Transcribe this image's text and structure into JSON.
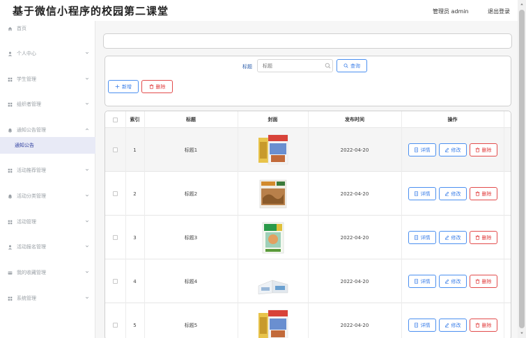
{
  "header": {
    "title": "基于微信小程序的校园第二课堂",
    "user_label": "管理员 admin",
    "logout_label": "退出登录"
  },
  "sidebar": {
    "items": [
      {
        "label": "首页",
        "icon": "home-icon"
      },
      {
        "label": "个人中心",
        "icon": "user-icon"
      },
      {
        "label": "学生管理",
        "icon": "grid-icon"
      },
      {
        "label": "组织者管理",
        "icon": "grid-icon"
      },
      {
        "label": "通知公告管理",
        "icon": "bell-icon"
      },
      {
        "label": "活动推荐管理",
        "icon": "grid-icon"
      },
      {
        "label": "活动分类管理",
        "icon": "bell-icon"
      },
      {
        "label": "活动管理",
        "icon": "grid-icon"
      },
      {
        "label": "活动报名管理",
        "icon": "user-icon"
      },
      {
        "label": "我的收藏管理",
        "icon": "card-icon"
      },
      {
        "label": "系统管理",
        "icon": "grid-icon"
      }
    ],
    "active_sub": "通知公告"
  },
  "search": {
    "label": "标题",
    "placeholder": "标题",
    "query_label": "查询",
    "add_label": "新增",
    "delete_label": "删除"
  },
  "table": {
    "headers": {
      "index": "索引",
      "title": "标题",
      "cover": "封面",
      "time": "发布时间",
      "ops": "操作"
    },
    "rows": [
      {
        "index": "1",
        "title": "标题1",
        "time": "2022-04-20",
        "cover": "magazine-book-cover"
      },
      {
        "index": "2",
        "title": "标题2",
        "time": "2022-04-20",
        "cover": "xinjiaoyu-cover"
      },
      {
        "index": "3",
        "title": "标题3",
        "time": "2022-04-20",
        "cover": "qingnian-wenzhai-cover"
      },
      {
        "index": "4",
        "title": "标题4",
        "time": "2022-04-20",
        "cover": "open-magazine-cover"
      },
      {
        "index": "5",
        "title": "标题5",
        "time": "2022-04-20",
        "cover": "magazine-book-cover"
      }
    ],
    "detail_label": "详情",
    "edit_label": "修改",
    "delete_label": "删除"
  },
  "colors": {
    "primary": "#3a7ee8",
    "danger": "#e03a3a",
    "active_bg": "#e8eaf6"
  }
}
